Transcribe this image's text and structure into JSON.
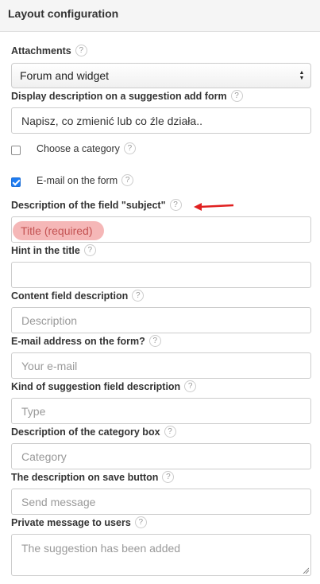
{
  "panel": {
    "title": "Layout configuration"
  },
  "help_glyph": "?",
  "attachments": {
    "label": "Attachments",
    "selected": "Forum and widget",
    "arrow_up": "▲",
    "arrow_down": "▼"
  },
  "display_description": {
    "label": "Display description on a suggestion add form",
    "value": "Napisz, co zmienić lub co źle działa.."
  },
  "choose_category": {
    "label": "Choose a category",
    "checked": false
  },
  "email_on_form": {
    "label": "E-mail on the form",
    "checked": true
  },
  "subject_description": {
    "label": "Description of the field \"subject\"",
    "placeholder": "Title (required)"
  },
  "hint_in_title": {
    "label": "Hint in the title",
    "value": ""
  },
  "content_field": {
    "label": "Content field description",
    "placeholder": "Description"
  },
  "email_address": {
    "label": "E-mail address on the form?",
    "placeholder": "Your e-mail"
  },
  "kind_of_suggestion": {
    "label": "Kind of suggestion field description",
    "placeholder": "Type"
  },
  "category_box": {
    "label": "Description of the category box",
    "placeholder": "Category"
  },
  "save_button_desc": {
    "label": "The description on save button",
    "placeholder": "Send message"
  },
  "private_message": {
    "label": "Private message to users",
    "placeholder": "The suggestion has been added"
  },
  "colors": {
    "accent": "#1e7cf2",
    "annotation_red": "#e02020",
    "highlight": "#f3aaaa"
  }
}
